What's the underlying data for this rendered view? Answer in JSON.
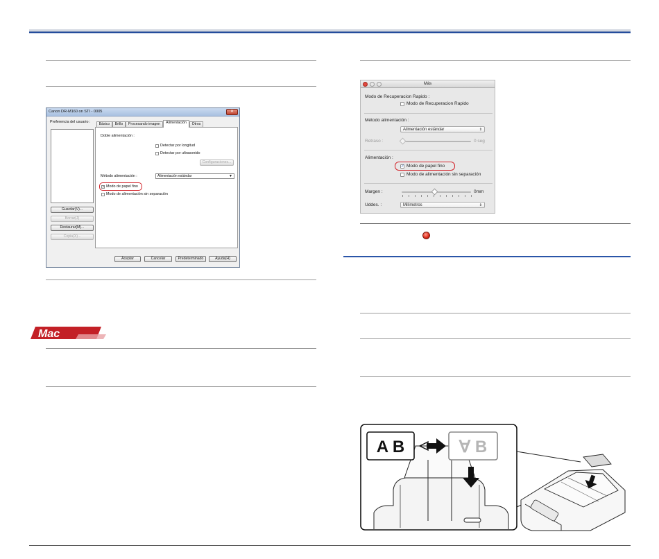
{
  "windows_dialog": {
    "title": "Canon DR-M160 on STI - 0005",
    "close": "✕",
    "pref_label": "Preferencia del usuario :",
    "buttons": [
      "Guardar(V)...",
      "Borrar(J)",
      "Restaurar(M)...",
      "Copia(X)..."
    ],
    "tabs": [
      "Básico",
      "Brillo",
      "Procesando imagen",
      "Alimentación",
      "Otros"
    ],
    "active_tab": "Alimentación",
    "double_feed_label": "Doble alimentación :",
    "detect_length": "Detectar por longitud",
    "detect_ultrasonic": "Detectar por ultrasonido",
    "config_button": "Configuraciones...",
    "feed_method_label": "Método alimentación :",
    "feed_method_value": "Alimentación estándar",
    "thin_paper": "Modo de papel fino",
    "thin_paper_checked": "✓",
    "no_separation": "Modo de alimentación sin separación",
    "footer_buttons": [
      "Aceptar",
      "Cancelar",
      "Predeterminado",
      "Ayuda(H)"
    ]
  },
  "mac_dialog": {
    "title": "Más",
    "rapid_recovery_label": "Modo de Recuperacion Rapido :",
    "rapid_recovery_option": "Modo de Recuperacion Rapido",
    "feed_method_label": "Método alimentación :",
    "feed_method_value": "Alimentación estándar",
    "delay_label": "Retraso :",
    "delay_value": "0 seg",
    "feeding_label": "Alimentación :",
    "thin_paper": "Modo de papel fino",
    "thin_paper_checked": "✓",
    "no_separation": "Modo de alimentación sin separación",
    "margin_label": "Margen :",
    "margin_value": "0mm",
    "units_label": "Uddes. :",
    "units_value": "Milímetros"
  },
  "mac_badge": {
    "text": "Mac"
  },
  "illustration": {
    "original_label": "A B",
    "flipped_label": "∀ B"
  },
  "colors": {
    "accent_blue": "#2a55a8",
    "highlight_red": "#d2232a",
    "badge_red": "#c32026"
  }
}
